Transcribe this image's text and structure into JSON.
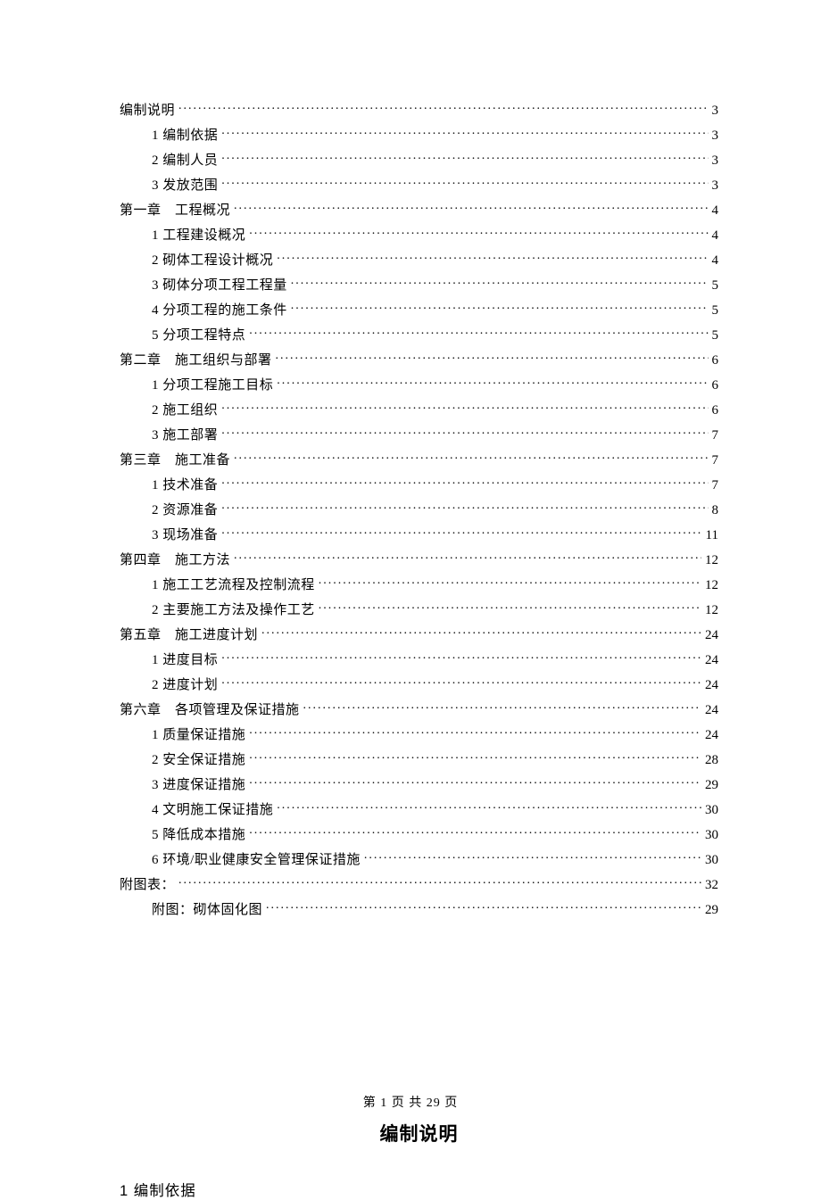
{
  "toc": [
    {
      "level": 0,
      "title": "编制说明",
      "page": "3"
    },
    {
      "level": 1,
      "title": "1 编制依据",
      "page": "3"
    },
    {
      "level": 1,
      "title": "2 编制人员",
      "page": "3"
    },
    {
      "level": 1,
      "title": "3 发放范围",
      "page": "3"
    },
    {
      "level": 0,
      "title": "第一章　工程概况",
      "page": "4"
    },
    {
      "level": 1,
      "title": "1 工程建设概况",
      "page": "4"
    },
    {
      "level": 1,
      "title": "2 砌体工程设计概况",
      "page": "4"
    },
    {
      "level": 1,
      "title": "3 砌体分项工程工程量",
      "page": "5"
    },
    {
      "level": 1,
      "title": "4 分项工程的施工条件",
      "page": "5"
    },
    {
      "level": 1,
      "title": "5 分项工程特点",
      "page": "5"
    },
    {
      "level": 0,
      "title": "第二章　施工组织与部署",
      "page": "6"
    },
    {
      "level": 1,
      "title": "1 分项工程施工目标",
      "page": "6"
    },
    {
      "level": 1,
      "title": "2 施工组织",
      "page": "6"
    },
    {
      "level": 1,
      "title": "3 施工部署",
      "page": "7"
    },
    {
      "level": 0,
      "title": "第三章　施工准备",
      "page": "7"
    },
    {
      "level": 1,
      "title": "1 技术准备",
      "page": "7"
    },
    {
      "level": 1,
      "title": "2 资源准备",
      "page": "8"
    },
    {
      "level": 1,
      "title": "3 现场准备",
      "page": "11"
    },
    {
      "level": 0,
      "title": "第四章　施工方法",
      "page": "12"
    },
    {
      "level": 1,
      "title": "1 施工工艺流程及控制流程",
      "page": "12"
    },
    {
      "level": 1,
      "title": "2 主要施工方法及操作工艺",
      "page": "12"
    },
    {
      "level": 0,
      "title": "第五章　施工进度计划",
      "page": "24"
    },
    {
      "level": 1,
      "title": "1 进度目标",
      "page": "24"
    },
    {
      "level": 1,
      "title": "2 进度计划",
      "page": "24"
    },
    {
      "level": 0,
      "title": "第六章　各项管理及保证措施",
      "page": "24"
    },
    {
      "level": 1,
      "title": "1 质量保证措施",
      "page": "24"
    },
    {
      "level": 1,
      "title": "2 安全保证措施",
      "page": "28"
    },
    {
      "level": 1,
      "title": "3 进度保证措施",
      "page": "29"
    },
    {
      "level": 1,
      "title": "4 文明施工保证措施",
      "page": "30"
    },
    {
      "level": 1,
      "title": "5 降低成本措施",
      "page": "30"
    },
    {
      "level": 1,
      "title": "6 环境/职业健康安全管理保证措施",
      "page": "30"
    },
    {
      "level": 0,
      "title": "附图表：",
      "page": "32"
    },
    {
      "level": 1,
      "title": "附图：砌体固化图",
      "page": "29"
    }
  ],
  "body": {
    "heading": "编制说明",
    "subheading": "1 编制依据"
  },
  "footer": "第 1 页 共 29 页"
}
